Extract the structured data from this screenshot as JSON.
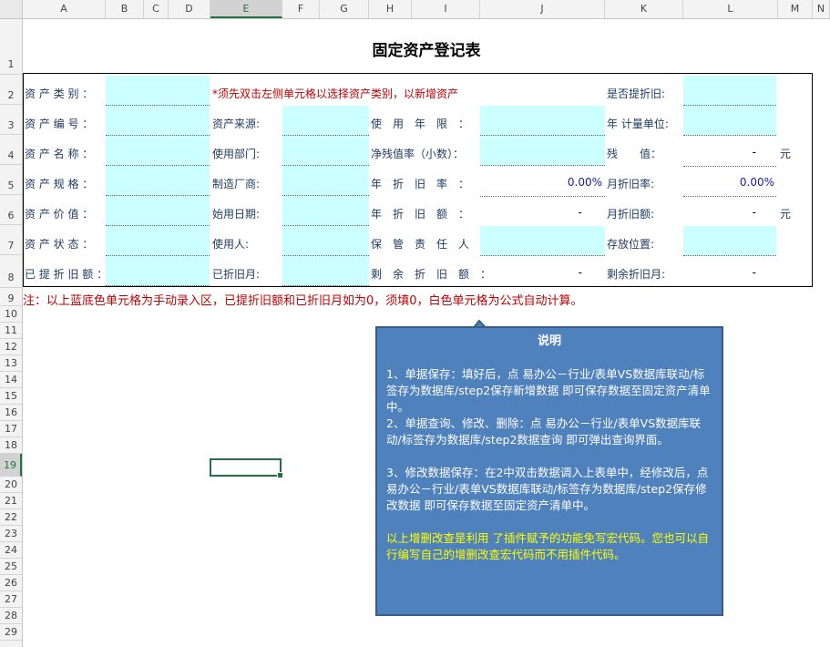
{
  "columns": [
    "A",
    "B",
    "C",
    "D",
    "E",
    "F",
    "G",
    "H",
    "I",
    "J",
    "K",
    "L",
    "M",
    "N"
  ],
  "selected_column": "E",
  "rows": [
    "1",
    "2",
    "3",
    "4",
    "5",
    "6",
    "7",
    "8",
    "9",
    "10",
    "11",
    "12",
    "13",
    "14",
    "15",
    "16",
    "17",
    "18",
    "19",
    "20",
    "21",
    "22",
    "23",
    "24",
    "25",
    "26",
    "27",
    "28",
    "29"
  ],
  "selected_row": "19",
  "title": "固定资产登记表",
  "form": {
    "asset_category": "资 产 类 别 ：",
    "category_hint": "*须先双击左侧单元格以选择资产类别，以新增资产",
    "depreciate_flag": "是否提折旧:",
    "asset_code": "资 产 编 号 ：",
    "asset_source": "资产来源:",
    "useful_life": "使　用　年　限　：",
    "annual_unit": "年 计量单位:",
    "asset_name": "资 产 名 称 ：",
    "use_department": "使用部门:",
    "net_salvage_rate": "净残值率（小数）：",
    "salvage_value": "残　　值：",
    "salvage_value_amount": "-",
    "salvage_unit": "元",
    "asset_spec": "资 产 规 格 ：",
    "manufacturer": "制造厂商:",
    "annual_dep_rate": "年　折　旧　率　：",
    "annual_dep_rate_value": "0.00%",
    "monthly_dep_rate": "月折旧率:",
    "monthly_dep_rate_value": "0.00%",
    "asset_value": "资 产 价 值 ：",
    "start_date": "始用日期:",
    "annual_dep_amount": "年　折　旧　额　：",
    "annual_dep_amount_value": "-",
    "monthly_dep_amount": "月折旧额:",
    "monthly_dep_amount_value": "-",
    "monthly_dep_unit": "元",
    "asset_status": "资 产 状 态 ：",
    "user": "使用人:",
    "custodian": "保　管　责　任　人　：",
    "storage_location": "存放位置:",
    "accum_dep": "已 提 折 旧 额 ：",
    "months_depreciated": "已折旧月:",
    "remaining_dep": "剩　余　折　旧　额　：",
    "remaining_dep_value": "-",
    "remaining_months": "剩余折旧月:",
    "remaining_months_value": "-"
  },
  "note": "注：以上蓝底色单元格为手动录入区，已提折旧额和已折旧月如为0，须填0，白色单元格为公式自动计算。",
  "callout": {
    "title": "说明",
    "p1": "1、单据保存：填好后，点 易办公－行业/表单VS数据库联动/标签存为数据库/step2保存新增数据 即可保存数据至固定资产清单中。",
    "p2": "2、单据查询、修改、删除：点 易办公－行业/表单VS数据库联动/标签存为数据库/step2数据查询  即可弹出查询界面。",
    "p3": "3、修改数据保存：在2中双击数据调入上表单中，经修改后，点 易办公－行业/表单VS数据库联动/标签存为数据库/step2保存修改数据 即可保存数据至固定资产清单中。",
    "p4": "以上增删改查是利用 了插件赋予的功能免写宏代码。您也可以自行编写自己的增删改查宏代码而不用插件代码。"
  },
  "colors": {
    "input_fill": "#ccffff",
    "callout_fill": "#4f81bd",
    "note_red": "#c00000",
    "select_green": "#217346"
  }
}
